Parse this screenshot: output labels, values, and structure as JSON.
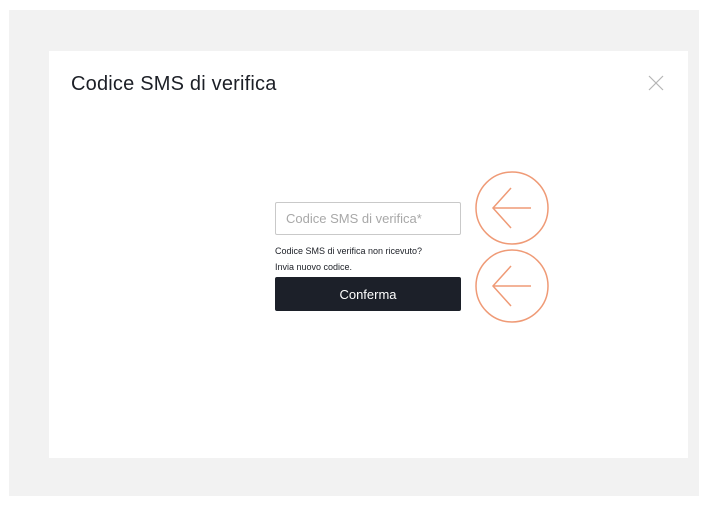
{
  "modal": {
    "title": "Codice SMS di verifica",
    "close_icon": "close-icon"
  },
  "form": {
    "code_input": {
      "placeholder": "Codice SMS di verifica*",
      "value": ""
    },
    "help_question": "Codice SMS di verifica non ricevuto?",
    "resend_link": "Invia nuovo codice.",
    "confirm_label": "Conferma"
  },
  "annotations": [
    {
      "icon": "arrow-left-icon",
      "target": "code-input"
    },
    {
      "icon": "arrow-left-icon",
      "target": "confirm-button"
    }
  ],
  "colors": {
    "backdrop": "#f2f2f2",
    "modal_bg": "#ffffff",
    "primary_button": "#1c2029",
    "annotation": "#ef9a76",
    "input_border": "#c9c9c9"
  }
}
